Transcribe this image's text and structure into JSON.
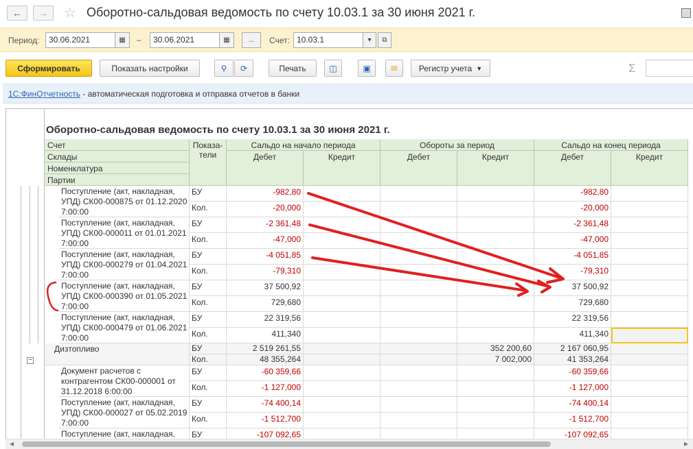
{
  "window": {
    "title": "Оборотно-сальдовая ведомость по счету 10.03.1 за 30 июня 2021 г."
  },
  "params": {
    "period_label": "Период:",
    "date_from": "30.06.2021",
    "date_to": "30.06.2021",
    "dash": "–",
    "dots": "...",
    "account_label": "Счет:",
    "account": "10.03.1"
  },
  "toolbar": {
    "generate": "Сформировать",
    "show_settings": "Показать настройки",
    "print": "Печать",
    "registry": "Регистр учета",
    "sigma": "Σ"
  },
  "infobar": {
    "link": "1С:ФинОтчетность",
    "text": " - автоматическая подготовка и отправка отчетов в банки"
  },
  "report": {
    "title": "Оборотно-сальдовая ведомость по счету 10.03.1 за 30 июня 2021 г.",
    "hdr_left": [
      "Счет",
      "Склады",
      "Номенклатура",
      "Партии"
    ],
    "hdr_ind": "Показа-\nтели",
    "hdr_groups": [
      "Сальдо на начало периода",
      "Обороты за период",
      "Сальдо на конец периода"
    ],
    "hdr_sub": [
      "Дебет",
      "Кредит",
      "Дебет",
      "Кредит",
      "Дебет",
      "Кредит"
    ],
    "rows": [
      {
        "desc": "Поступление (акт, накладная, УПД) СК00-000875 от 01.12.2020 7:00:00",
        "lines": [
          {
            "ind": "БУ",
            "sd": "-982,80",
            "ob_d": "",
            "ob_k": "",
            "ed": "-982,80"
          },
          {
            "ind": "Кол.",
            "sd": "-20,000",
            "ob_d": "",
            "ob_k": "",
            "ed": "-20,000"
          }
        ]
      },
      {
        "desc": "Поступление (акт, накладная, УПД) СК00-000011 от 01.01.2021 7:00:00",
        "lines": [
          {
            "ind": "БУ",
            "sd": "-2 361,48",
            "ob_d": "",
            "ob_k": "",
            "ed": "-2 361,48"
          },
          {
            "ind": "Кол.",
            "sd": "-47,000",
            "ob_d": "",
            "ob_k": "",
            "ed": "-47,000"
          }
        ]
      },
      {
        "desc": "Поступление (акт, накладная, УПД) СК00-000279 от 01.04.2021 7:00:00",
        "lines": [
          {
            "ind": "БУ",
            "sd": "-4 051,85",
            "ob_d": "",
            "ob_k": "",
            "ed": "-4 051,85"
          },
          {
            "ind": "Кол.",
            "sd": "-79,310",
            "ob_d": "",
            "ob_k": "",
            "ed": "-79,310"
          }
        ]
      },
      {
        "desc": "Поступление (акт, накладная, УПД) СК00-000390 от 01.05.2021 7:00:00",
        "lines": [
          {
            "ind": "БУ",
            "sd": "37 500,92",
            "ob_d": "",
            "ob_k": "",
            "ed": "37 500,92"
          },
          {
            "ind": "Кол.",
            "sd": "729,680",
            "ob_d": "",
            "ob_k": "",
            "ed": "729,680"
          }
        ]
      },
      {
        "desc": "Поступление (акт, накладная, УПД) СК00-000479 от 01.06.2021 7:00:00",
        "lines": [
          {
            "ind": "БУ",
            "sd": "22 319,56",
            "ob_d": "",
            "ob_k": "",
            "ed": "22 319,56"
          },
          {
            "ind": "Кол.",
            "sd": "411,340",
            "ob_d": "",
            "ob_k": "",
            "ed": "411,340"
          }
        ]
      },
      {
        "desc": "Дизтопливо",
        "group": true,
        "lines": [
          {
            "ind": "БУ",
            "sd": "2 519 261,55",
            "ob_d": "",
            "ob_k": "352 200,60",
            "ed": "2 167 060,95"
          },
          {
            "ind": "Кол.",
            "sd": "48 355,264",
            "ob_d": "",
            "ob_k": "7 002,000",
            "ed": "41 353,264"
          }
        ]
      },
      {
        "desc": "Документ расчетов с контрагентом СК00-000001 от 31.12.2018 6:00:00",
        "lines": [
          {
            "ind": "БУ",
            "sd": "-60 359,66",
            "ob_d": "",
            "ob_k": "",
            "ed": "-60 359,66"
          },
          {
            "ind": "Кол.",
            "sd": "-1 127,000",
            "ob_d": "",
            "ob_k": "",
            "ed": "-1 127,000"
          }
        ]
      },
      {
        "desc": "Поступление (акт, накладная, УПД) СК00-000027 от 05.02.2019 7:00:00",
        "lines": [
          {
            "ind": "БУ",
            "sd": "-74 400,14",
            "ob_d": "",
            "ob_k": "",
            "ed": "-74 400,14"
          },
          {
            "ind": "Кол.",
            "sd": "-1 512,700",
            "ob_d": "",
            "ob_k": "",
            "ed": "-1 512,700"
          }
        ]
      },
      {
        "desc": "Поступление (акт, накладная,",
        "lines": [
          {
            "ind": "БУ",
            "sd": "-107 092,65",
            "ob_d": "",
            "ob_k": "",
            "ed": "-107 092,65"
          }
        ]
      }
    ]
  }
}
